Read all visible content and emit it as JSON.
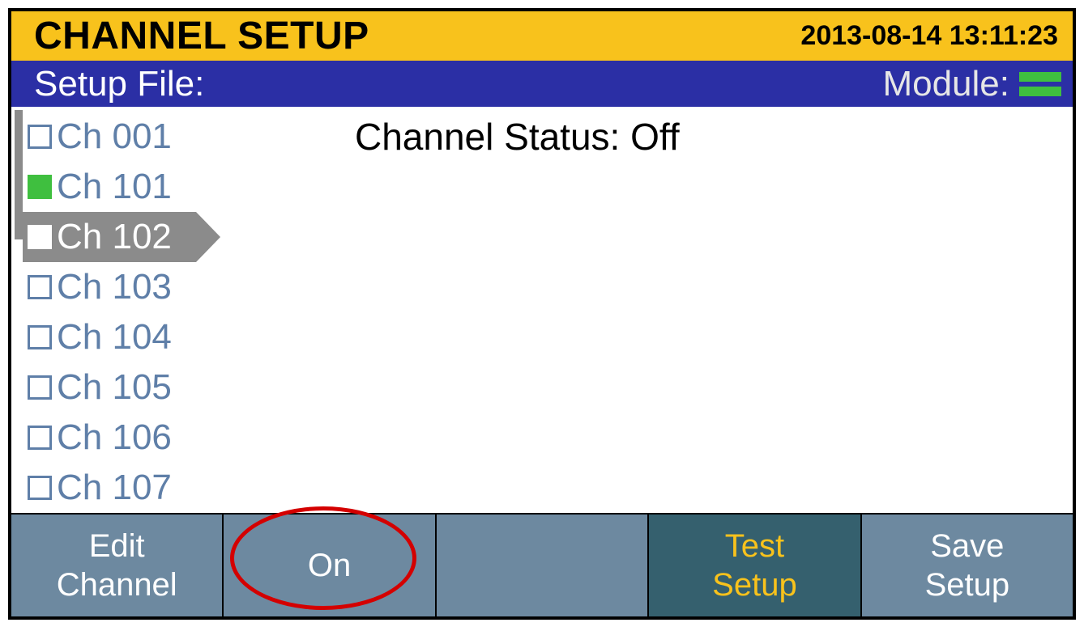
{
  "header": {
    "title": "CHANNEL SETUP",
    "timestamp": "2013-08-14 13:11:23"
  },
  "filebar": {
    "setup_label": "Setup File:",
    "module_label": "Module:"
  },
  "channels": [
    {
      "label": "Ch 001",
      "checked": false,
      "selected": false
    },
    {
      "label": "Ch 101",
      "checked": true,
      "selected": false
    },
    {
      "label": "Ch 102",
      "checked": false,
      "selected": true
    },
    {
      "label": "Ch 103",
      "checked": false,
      "selected": false
    },
    {
      "label": "Ch 104",
      "checked": false,
      "selected": false
    },
    {
      "label": "Ch 105",
      "checked": false,
      "selected": false
    },
    {
      "label": "Ch 106",
      "checked": false,
      "selected": false
    },
    {
      "label": "Ch 107",
      "checked": false,
      "selected": false
    }
  ],
  "status": {
    "label": "Channel Status:",
    "value": "Off"
  },
  "softkeys": {
    "k1": "Edit\nChannel",
    "k2": "On",
    "k3": "",
    "k4": "Test\nSetup",
    "k5": "Save\nSetup"
  }
}
